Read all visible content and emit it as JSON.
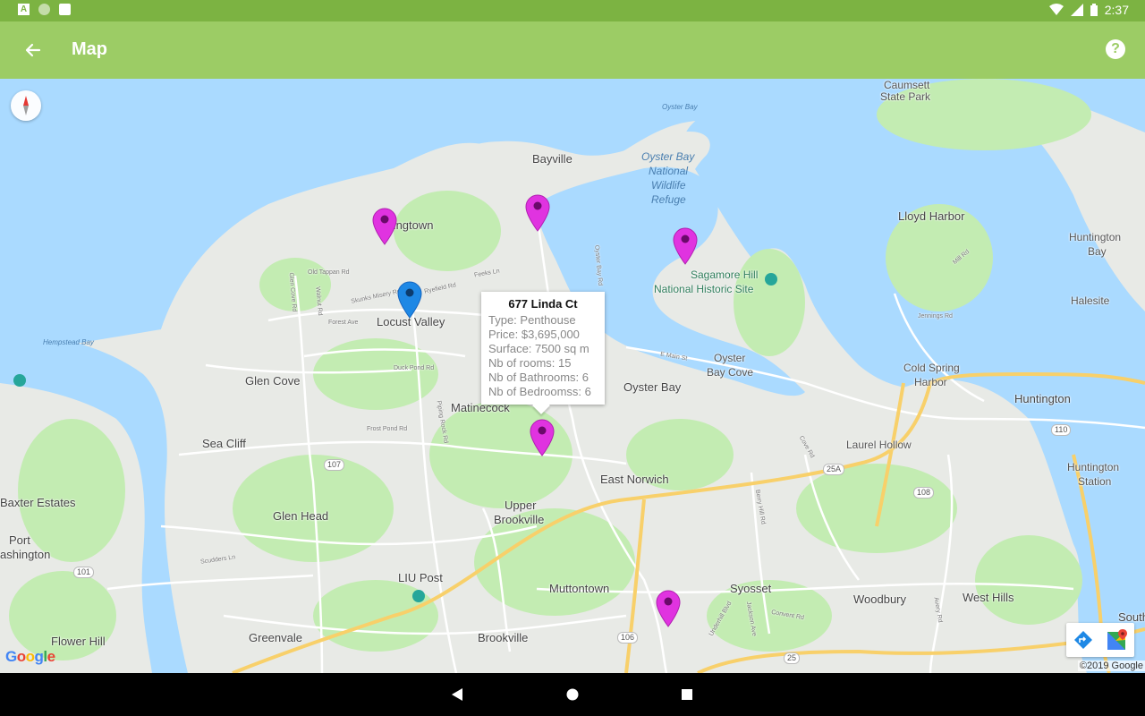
{
  "status_bar": {
    "time": "2:37",
    "left_icons": [
      "a-icon",
      "circle-icon",
      "sd-card-icon"
    ],
    "right_icons": [
      "wifi-icon",
      "signal-icon",
      "battery-icon"
    ]
  },
  "app_bar": {
    "title": "Map",
    "back_icon": "arrow-back-icon",
    "help_icon": "help-icon"
  },
  "map": {
    "places": [
      "Caumsett",
      "State Park",
      "Oyster Bay",
      "Bayville",
      "Oyster Bay",
      "National",
      "Wildlife",
      "Refuge",
      "Lattingtown",
      "Lloyd Harbor",
      "Huntington",
      "Bay",
      "Sagamore Hill",
      "National Historic Site",
      "Halesite",
      "Locust Valley",
      "Oyster",
      "Bay Cove",
      "Hempstead Bay",
      "Cold Spring",
      "Harbor",
      "Glen Cove",
      "Oyster Bay",
      "Huntington",
      "Matinecock",
      "Laurel Hollow",
      "Sea Cliff",
      "East Norwich",
      "Huntington",
      "Station",
      "Baxter Estates",
      "Upper",
      "Brookville",
      "Glen Head",
      "Port",
      "ashington",
      "LIU Post",
      "Muttontown",
      "Syosset",
      "Woodbury",
      "West Hills",
      "Flower Hill",
      "Greenvale",
      "Brookville",
      "South"
    ],
    "roads": [
      "Old Tappan Rd",
      "Skunks Misery Rd",
      "Forest Ave",
      "Ryefield Rd",
      "Feeks Ln",
      "Duck Pond Rd",
      "Frost Pond Rd",
      "Piping Rock Rd",
      "E Main St",
      "Cove Rd",
      "Berry Hill Rd",
      "Jennings Rd",
      "Mill Rd",
      "Scudders Ln",
      "Jackson Ave",
      "Convent Rd",
      "Underhill Blvd",
      "Avery Rd",
      "Walnut Rd",
      "Glen Cove Rd",
      "Oyster Bay Rd"
    ],
    "shields": [
      "107",
      "25A",
      "108",
      "110",
      "101",
      "106",
      "25"
    ],
    "compass_icon": "compass-icon",
    "attribution": "Google",
    "copyright": "©2019 Google",
    "tools": [
      "directions-icon",
      "google-maps-icon"
    ]
  },
  "info_window": {
    "title": "677 Linda Ct",
    "type": "Type: Penthouse",
    "price": "Price: $3,695,000",
    "surface": "Surface: 7500 sq m",
    "rooms": "Nb of rooms: 15",
    "bathrooms": "Nb of Bathrooms: 6",
    "bedrooms": "Nb of Bedroomss: 6"
  },
  "markers": {
    "property_color": "#e033e0",
    "user_color": "#1e88e5",
    "count_property": 5
  },
  "colors": {
    "status_bar": "#7cb342",
    "app_bar": "#9ccc65",
    "water": "#aadaff",
    "land": "#e8eae6",
    "park": "#c3ecb2",
    "highway": "#f8d06a"
  },
  "nav_bar": {
    "buttons": [
      "back-triangle-icon",
      "home-circle-icon",
      "recents-square-icon"
    ]
  }
}
